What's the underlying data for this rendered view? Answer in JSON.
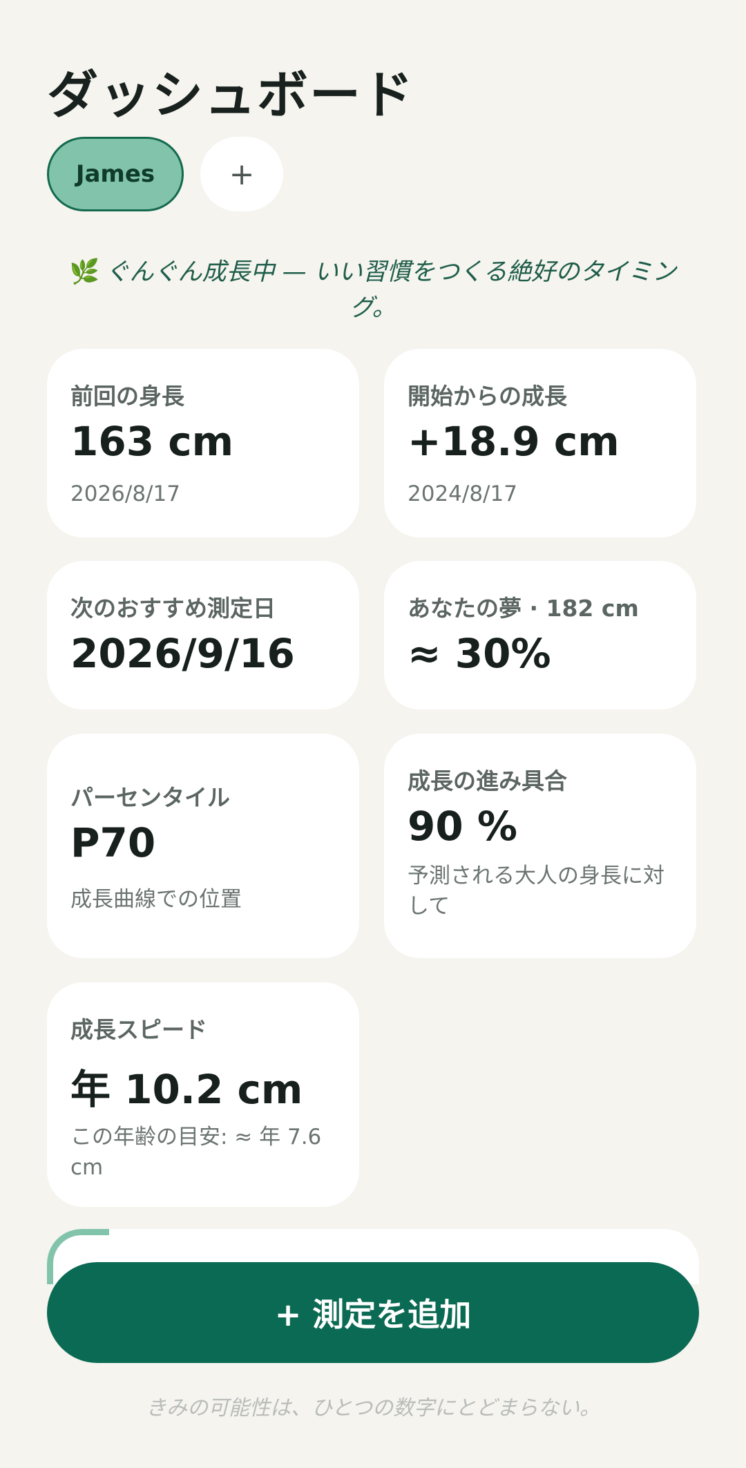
{
  "header": {
    "title": "ダッシュボード"
  },
  "profiles": {
    "active": "James",
    "add_symbol": "+"
  },
  "tagline": {
    "icon": "🌿",
    "text": "ぐんぐん成長中 — いい習慣をつくる絶好のタイミング。"
  },
  "cards": {
    "last_height": {
      "label": "前回の身長",
      "value": "163 cm",
      "sub": "2026/8/17"
    },
    "growth_since_start": {
      "label": "開始からの成長",
      "value": "+18.9 cm",
      "sub": "2024/8/17"
    },
    "next_measure": {
      "label": "次のおすすめ測定日",
      "value": "2026/9/16"
    },
    "dream": {
      "label": "あなたの夢 · 182 cm",
      "value": "≈ 30%"
    },
    "percentile": {
      "label": "パーセンタイル",
      "value": "P70",
      "sub": "成長曲線での位置"
    },
    "progress": {
      "label": "成長の進み具合",
      "value": "90 %",
      "sub": "予測される大人の身長に対して"
    },
    "speed": {
      "label": "成長スピード",
      "value": "年 10.2 cm",
      "sub": "この年齢の目安: ≈ 年 7.6 cm"
    }
  },
  "actions": {
    "add_measurement": "+ 測定を追加"
  },
  "footer": {
    "text": "きみの可能性は、ひとつの数字にとどまらない。"
  },
  "colors": {
    "accent": "#0b6a53",
    "chip": "#82c4ab",
    "background": "#f5f4ef"
  }
}
